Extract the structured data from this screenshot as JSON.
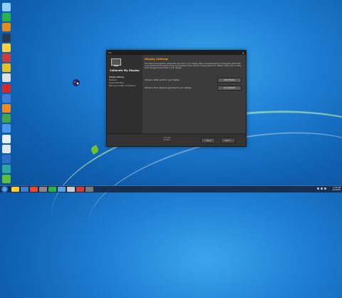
{
  "dialog": {
    "window_title": "File",
    "close_glyph": "✕",
    "left_title": "Calibrate My Display",
    "steps": [
      "Display Settings",
      "Measure",
      "Save Calibration",
      "Before And After Comparison"
    ],
    "section_title": "Display Settings",
    "description": "The white point selection adjusts the color tint on your display. D65 is recommended for photography while D50 is recommended for graphic design and prepress. If you want to choose what is the \"Native\" option and no white point changes will be made to your display.",
    "row1_label": "Choose a white point for your display:",
    "row1_value": "D65 (Photo)",
    "row2_label": "Choose a tone response (gamma) for your display:",
    "row2_value": "2.2 (default)",
    "brand_line1": "COLOR",
    "brand_line2": "MUNKI",
    "back_label": "< Back",
    "next_label": "Next >"
  },
  "desktop": {
    "icons": [
      {
        "name": "recycle-bin-icon",
        "color": "#8fd0ff"
      },
      {
        "name": "app-icon-green",
        "color": "#2ab34a"
      },
      {
        "name": "app-icon-orange",
        "color": "#e38c1a"
      },
      {
        "name": "steam-icon",
        "color": "#2b3a52"
      },
      {
        "name": "app-icon-yellow",
        "color": "#ffd23a"
      },
      {
        "name": "app-icon-red",
        "color": "#d13a3a"
      },
      {
        "name": "chrome-icon",
        "color": "#e8c020"
      },
      {
        "name": "app-icon-white",
        "color": "#e0e0e0"
      },
      {
        "name": "app-icon-red-2",
        "color": "#d9262a"
      },
      {
        "name": "app-icon-blue",
        "color": "#3d7fd6"
      },
      {
        "name": "app-icon-orange-2",
        "color": "#f08a1c"
      },
      {
        "name": "app-icon-green-2",
        "color": "#45a549"
      },
      {
        "name": "app-icon-blue-2",
        "color": "#4c96e8"
      },
      {
        "name": "app-icon-white-2",
        "color": "#e8eef5"
      },
      {
        "name": "app-icon-white-3",
        "color": "#dfe6ee"
      },
      {
        "name": "app-icon-blue-3",
        "color": "#2e6fc8"
      },
      {
        "name": "app-icon-teal",
        "color": "#2aa7a0"
      },
      {
        "name": "app-icon-green-3",
        "color": "#5cbf3b"
      }
    ]
  },
  "taskbar": {
    "items": [
      "#ffcc33",
      "#3d7fd6",
      "#e84a2a",
      "#888888",
      "#2ab34a",
      "#5aa0e6",
      "#cccccc",
      "#d13a3a",
      "#7a7a7a"
    ],
    "time": "5:24 PM",
    "date": "1/1/2016"
  }
}
